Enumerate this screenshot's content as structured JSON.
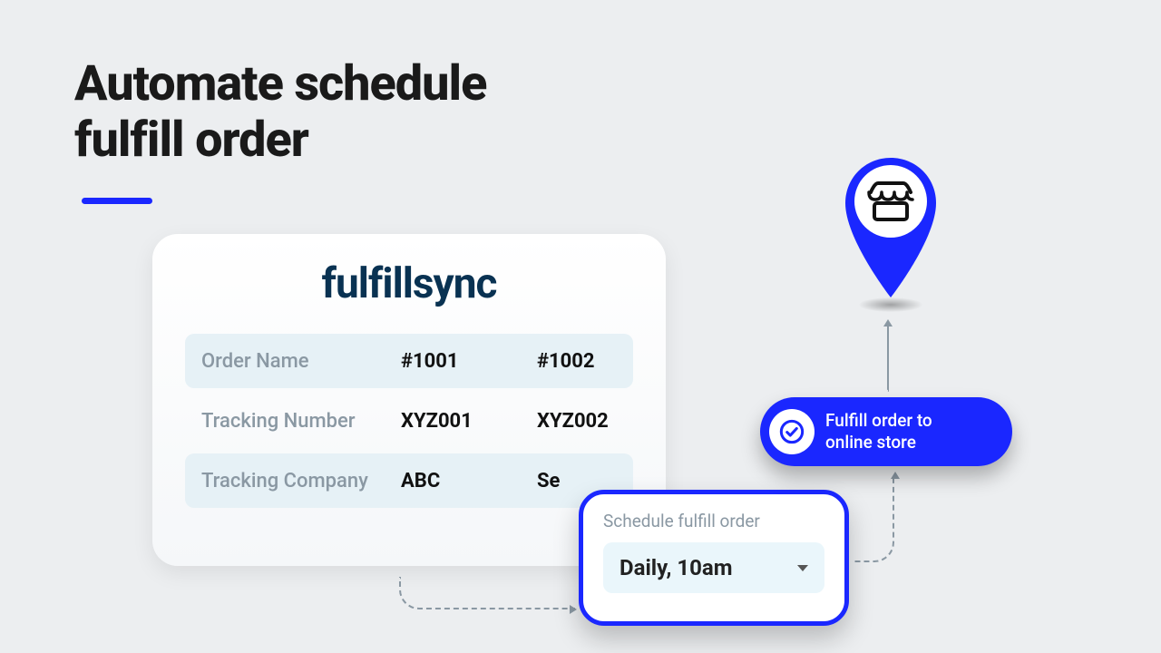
{
  "heading": "Automate schedule\nfulfill order",
  "card": {
    "brand": "fulfillsync",
    "labels": {
      "order_name": "Order Name",
      "tracking_number": "Tracking Number",
      "tracking_company": "Tracking Company"
    },
    "columns": [
      {
        "order_name": "#1001",
        "tracking_number": "XYZ001",
        "tracking_company": "ABC"
      },
      {
        "order_name": "#1002",
        "tracking_number": "XYZ002",
        "tracking_company": "Se"
      }
    ]
  },
  "popover": {
    "label": "Schedule fulfill order",
    "selected": "Daily, 10am"
  },
  "pill": {
    "text": "Fulfill order to\nonline store"
  },
  "colors": {
    "accent": "#1a27ff",
    "brand_text": "#093252",
    "muted": "#8a98a3",
    "tint": "#e6f1f6"
  }
}
